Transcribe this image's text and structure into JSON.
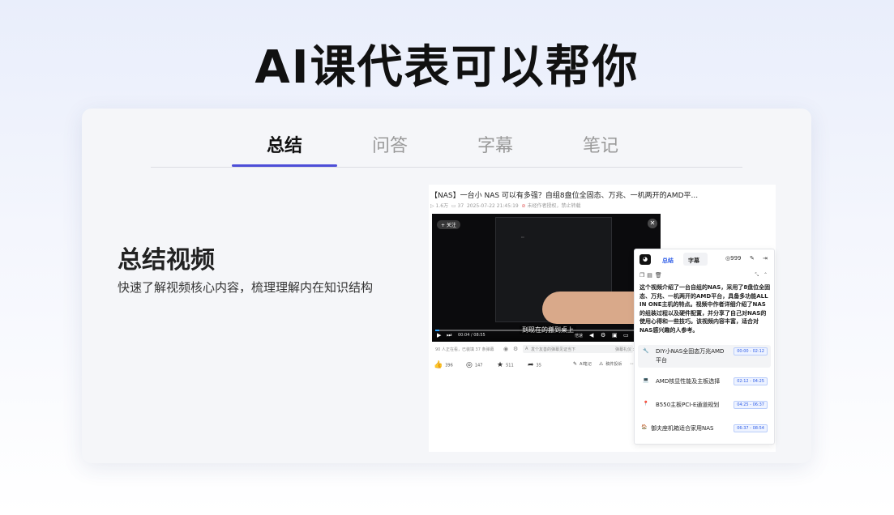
{
  "headline": "AI课代表可以帮你",
  "tabs": [
    {
      "label": "总结",
      "active": true
    },
    {
      "label": "问答",
      "active": false
    },
    {
      "label": "字幕",
      "active": false
    },
    {
      "label": "笔记",
      "active": false
    }
  ],
  "feature": {
    "title": "总结视频",
    "desc": "快速了解视频核心内容，梳理理解内在知识结构"
  },
  "video": {
    "title": "【NAS】一台小 NAS 可以有多强？自组8盘位全固态、万兆、一机两开的AMD平...",
    "views": "1.6万",
    "danmaku_count": "37",
    "date": "2025-07-22 21:45:19",
    "warning": "未经作者授权，禁止转载",
    "follow": "+ 关注",
    "subtitle": "到现在的搬到桌上",
    "time": "00:04 / 08:55",
    "speed": "倍速",
    "progress_fraction": 0.02,
    "viewer_line": "90 人正在看，已装填 37 条弹幕",
    "danmaku_placeholder": "发个友善的弹幕见证当下",
    "danmaku_etiquette": "弹幕礼仪 >",
    "likes": "396",
    "coins": "147",
    "favorites": "511",
    "shares": "35",
    "ai_note": "AI笔记",
    "report": "稿件投诉"
  },
  "panel": {
    "logo": "◕",
    "tab_summary": "总结",
    "tab_subtitle": "字幕",
    "credits": "999",
    "summary": "这个视频介绍了一台自组的NAS，采用了8盘位全固态、万兆、一机两开的AMD平台，具备多功能ALL IN ONE主机的特点。视频中作者详细介绍了NAS的组装过程以及硬件配置，并分享了自己对NAS的使用心得和一些技巧。该视频内容丰富，适合对NAS感兴趣的人参考。",
    "chapters": [
      {
        "icon": "🔧",
        "title": "DIY小NAS全固态万兆AMD平台",
        "range": "00:00 - 02:12"
      },
      {
        "icon": "💻",
        "title": "AMD核显性能及主板选择",
        "range": "02:12 - 04:25"
      },
      {
        "icon": "📍",
        "title": "B550主板PCI-E通道规划",
        "range": "04:25 - 06:37"
      },
      {
        "icon": "🏠",
        "title": "御夫座机箱适合家用NAS",
        "range": "06:37 - 08:54"
      }
    ]
  },
  "colors": {
    "accent": "#4d4ed8",
    "link": "#2f5ee8"
  }
}
